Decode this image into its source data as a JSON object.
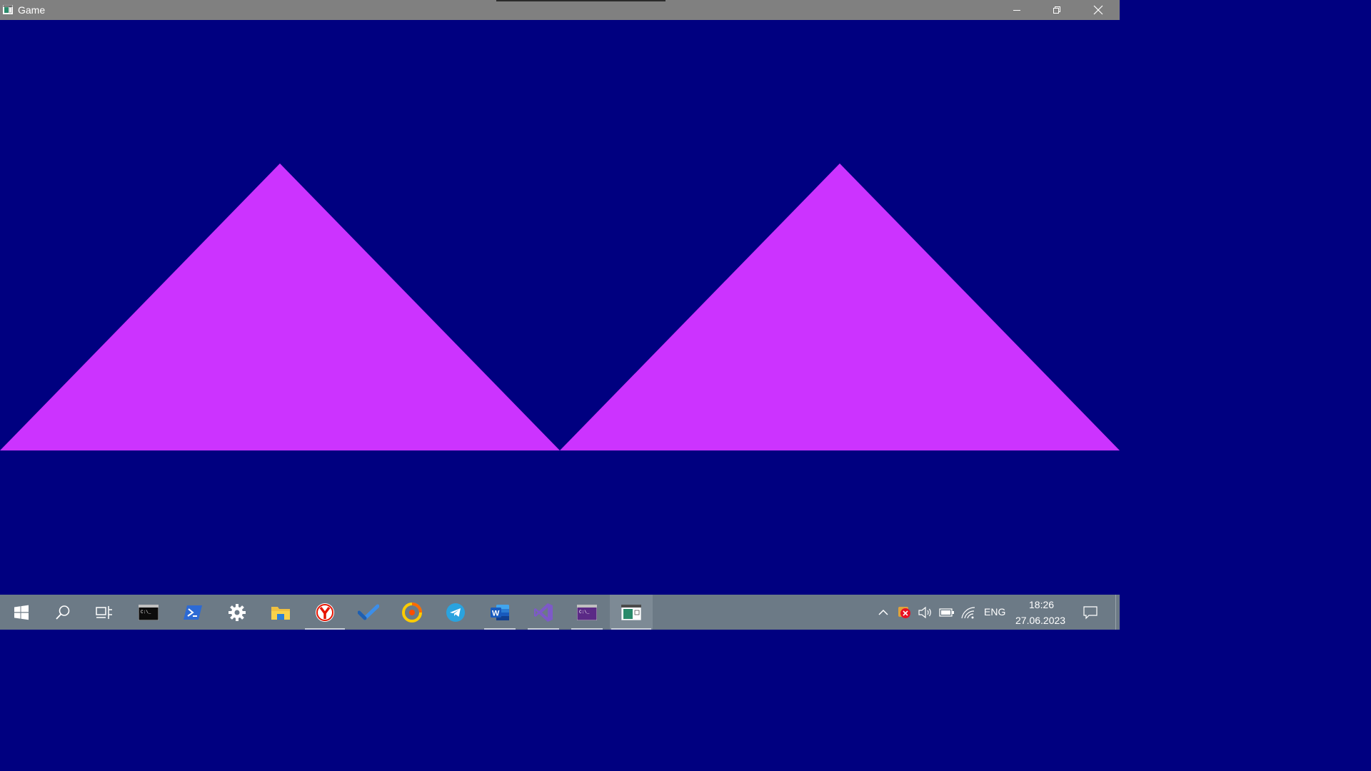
{
  "window": {
    "title": "Game",
    "minimize_icon": "minimize-icon",
    "restore_icon": "restore-icon",
    "close_icon": "close-icon"
  },
  "game": {
    "background_color": "#000080",
    "shape_color": "#cc33ff",
    "shapes": [
      "triangle",
      "triangle"
    ]
  },
  "taskbar": {
    "pinned": [
      {
        "name": "start-button",
        "icon": "windows-logo-icon"
      },
      {
        "name": "search-button",
        "icon": "search-icon"
      },
      {
        "name": "task-view-button",
        "icon": "task-view-icon"
      },
      {
        "name": "taskbar-cmd",
        "icon": "command-prompt-icon"
      },
      {
        "name": "taskbar-powershell",
        "icon": "powershell-icon"
      },
      {
        "name": "taskbar-settings",
        "icon": "gear-icon"
      },
      {
        "name": "taskbar-file-explorer",
        "icon": "folder-icon"
      },
      {
        "name": "taskbar-yandex",
        "icon": "yandex-browser-icon"
      },
      {
        "name": "taskbar-todo",
        "icon": "checkmark-icon"
      },
      {
        "name": "taskbar-music",
        "icon": "music-app-icon"
      },
      {
        "name": "taskbar-telegram",
        "icon": "telegram-icon"
      },
      {
        "name": "taskbar-word",
        "icon": "word-icon"
      },
      {
        "name": "taskbar-visual-studio",
        "icon": "visual-studio-icon"
      },
      {
        "name": "taskbar-console",
        "icon": "console-window-icon"
      },
      {
        "name": "taskbar-game",
        "icon": "game-window-icon"
      }
    ],
    "tray": {
      "language": "ENG",
      "time": "18:26",
      "date": "27.06.2023"
    }
  }
}
